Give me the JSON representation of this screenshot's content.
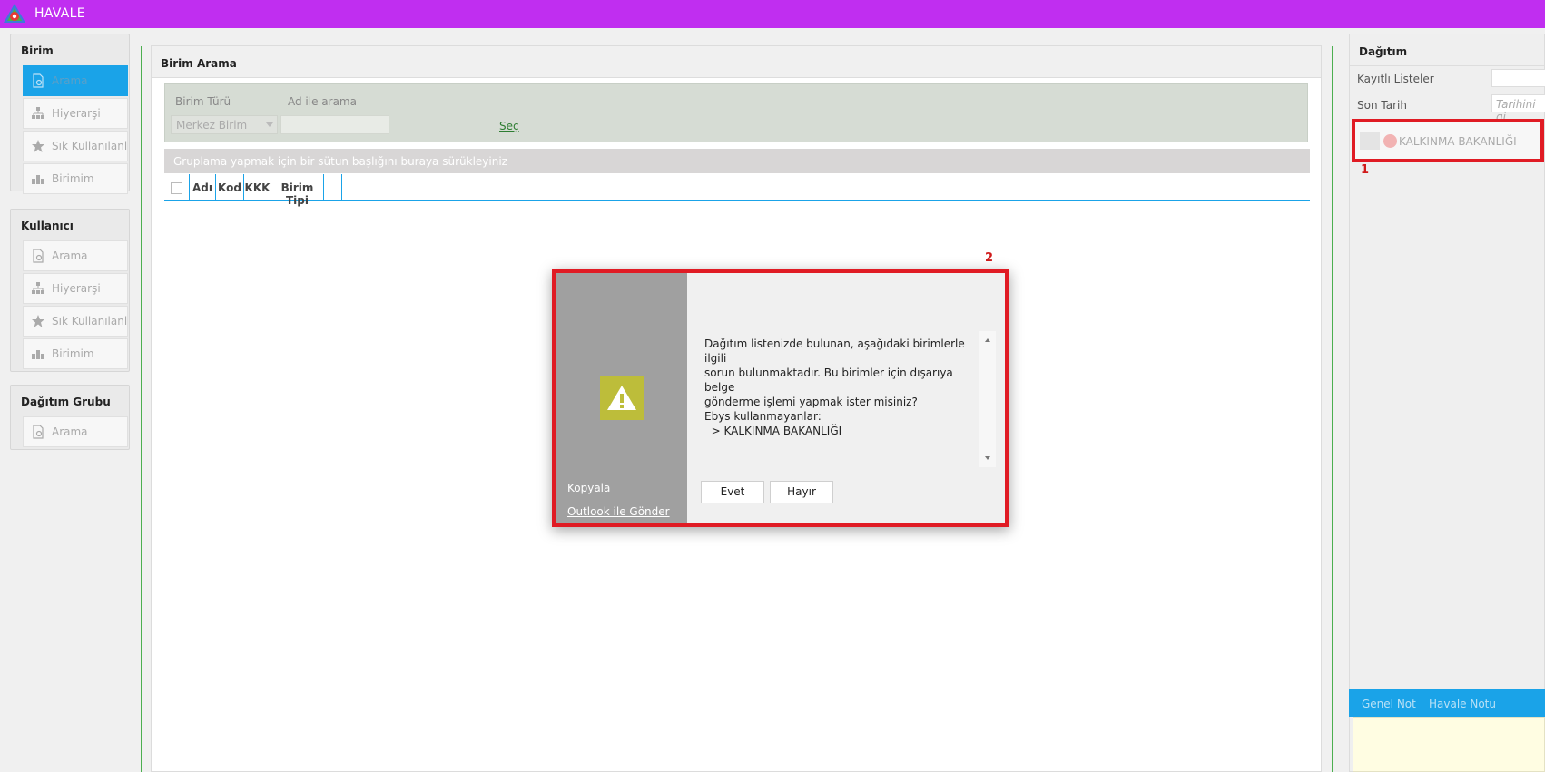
{
  "app": {
    "title": "HAVALE",
    "accent": "#c02ef0"
  },
  "sidebar": {
    "groups": [
      {
        "title": "Birim",
        "items": [
          {
            "label": "Arama",
            "icon": "document-search-icon"
          },
          {
            "label": "Hiyerarşi",
            "icon": "hierarchy-icon"
          },
          {
            "label": "Sık Kullanılanlar",
            "icon": "star-icon"
          },
          {
            "label": "Birimim",
            "icon": "org-units-icon"
          }
        ]
      },
      {
        "title": "Kullanıcı",
        "items": [
          {
            "label": "Arama",
            "icon": "document-search-icon"
          },
          {
            "label": "Hiyerarşi",
            "icon": "hierarchy-icon"
          },
          {
            "label": "Sık Kullanılanlar",
            "icon": "star-icon"
          },
          {
            "label": "Birimim",
            "icon": "org-units-icon"
          }
        ]
      },
      {
        "title": "Dağıtım Grubu",
        "items": [
          {
            "label": "Arama",
            "icon": "document-search-icon"
          }
        ]
      }
    ],
    "active_color": "#1aa3e8"
  },
  "search_panel": {
    "title": "Birim Arama",
    "unit_type_label": "Birim Türü",
    "unit_type_value": "Merkez Birim",
    "name_search_label": "Ad ile arama",
    "name_search_value": "",
    "select_link": "Seç",
    "group_hint": "Gruplama yapmak için bir sütun başlığını buraya sürükleyiniz",
    "columns": [
      "Adı",
      "Kod",
      "KKK",
      "Birim Tipi",
      ""
    ]
  },
  "distribution": {
    "title": "Dağıtım",
    "saved_lists_label": "Kayıtlı Listeler",
    "saved_lists_value": "",
    "due_date_label": "Son Tarih",
    "due_date_placeholder": "Tarihini gi",
    "recipient": "KALKINMA BAKANLIĞI",
    "marker": "1",
    "tabs": [
      "Genel Not",
      "Havale Notu"
    ]
  },
  "dialog": {
    "marker": "2",
    "icon": "warning-icon",
    "message_lines": [
      "Dağıtım listenizde bulunan, aşağıdaki birimlerle ilgili",
      "sorun bulunmaktadır. Bu birimler için dışarıya belge",
      "gönderme işlemi yapmak ister misiniz?",
      "Ebys kullanmayanlar:",
      "  > KALKINMA BAKANLIĞI"
    ],
    "copy_link": "Kopyala",
    "outlook_link": "Outlook ile Gönder",
    "yes_button": "Evet",
    "no_button": "Hayır"
  }
}
